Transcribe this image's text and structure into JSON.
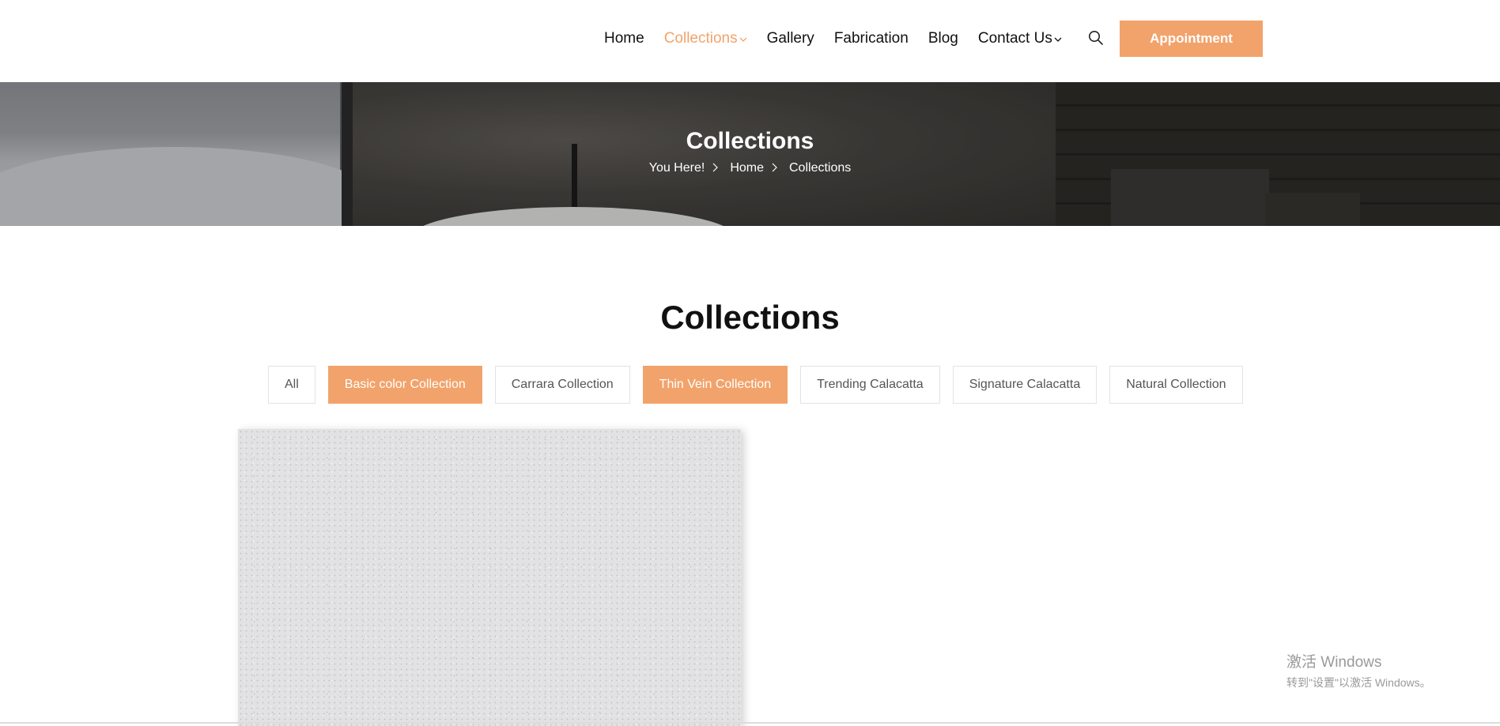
{
  "nav": {
    "items": [
      {
        "label": "Home",
        "active": false,
        "dropdown": false
      },
      {
        "label": "Collections",
        "active": true,
        "dropdown": true
      },
      {
        "label": "Gallery",
        "active": false,
        "dropdown": false
      },
      {
        "label": "Fabrication",
        "active": false,
        "dropdown": false
      },
      {
        "label": "Blog",
        "active": false,
        "dropdown": false
      },
      {
        "label": "Contact Us",
        "active": false,
        "dropdown": true
      }
    ],
    "search_icon": "search-icon",
    "appointment_label": "Appointment"
  },
  "hero": {
    "title": "Collections",
    "breadcrumb": {
      "prefix": "You Here!",
      "home": "Home",
      "current": "Collections"
    }
  },
  "section": {
    "title": "Collections",
    "filters": [
      {
        "label": "All",
        "active": false
      },
      {
        "label": "Basic color Collection",
        "active": true
      },
      {
        "label": "Carrara Collection",
        "active": false
      },
      {
        "label": "Thin Vein Collection",
        "active": true
      },
      {
        "label": "Trending Calacatta",
        "active": false
      },
      {
        "label": "Signature Calacatta",
        "active": false
      },
      {
        "label": "Natural Collection",
        "active": false
      }
    ]
  },
  "watermark": {
    "line1": "激活 Windows",
    "line2": "转到\"设置\"以激活 Windows。"
  },
  "colors": {
    "accent": "#f2a36b",
    "text": "#111111",
    "filter_border": "#e3e3e3"
  }
}
